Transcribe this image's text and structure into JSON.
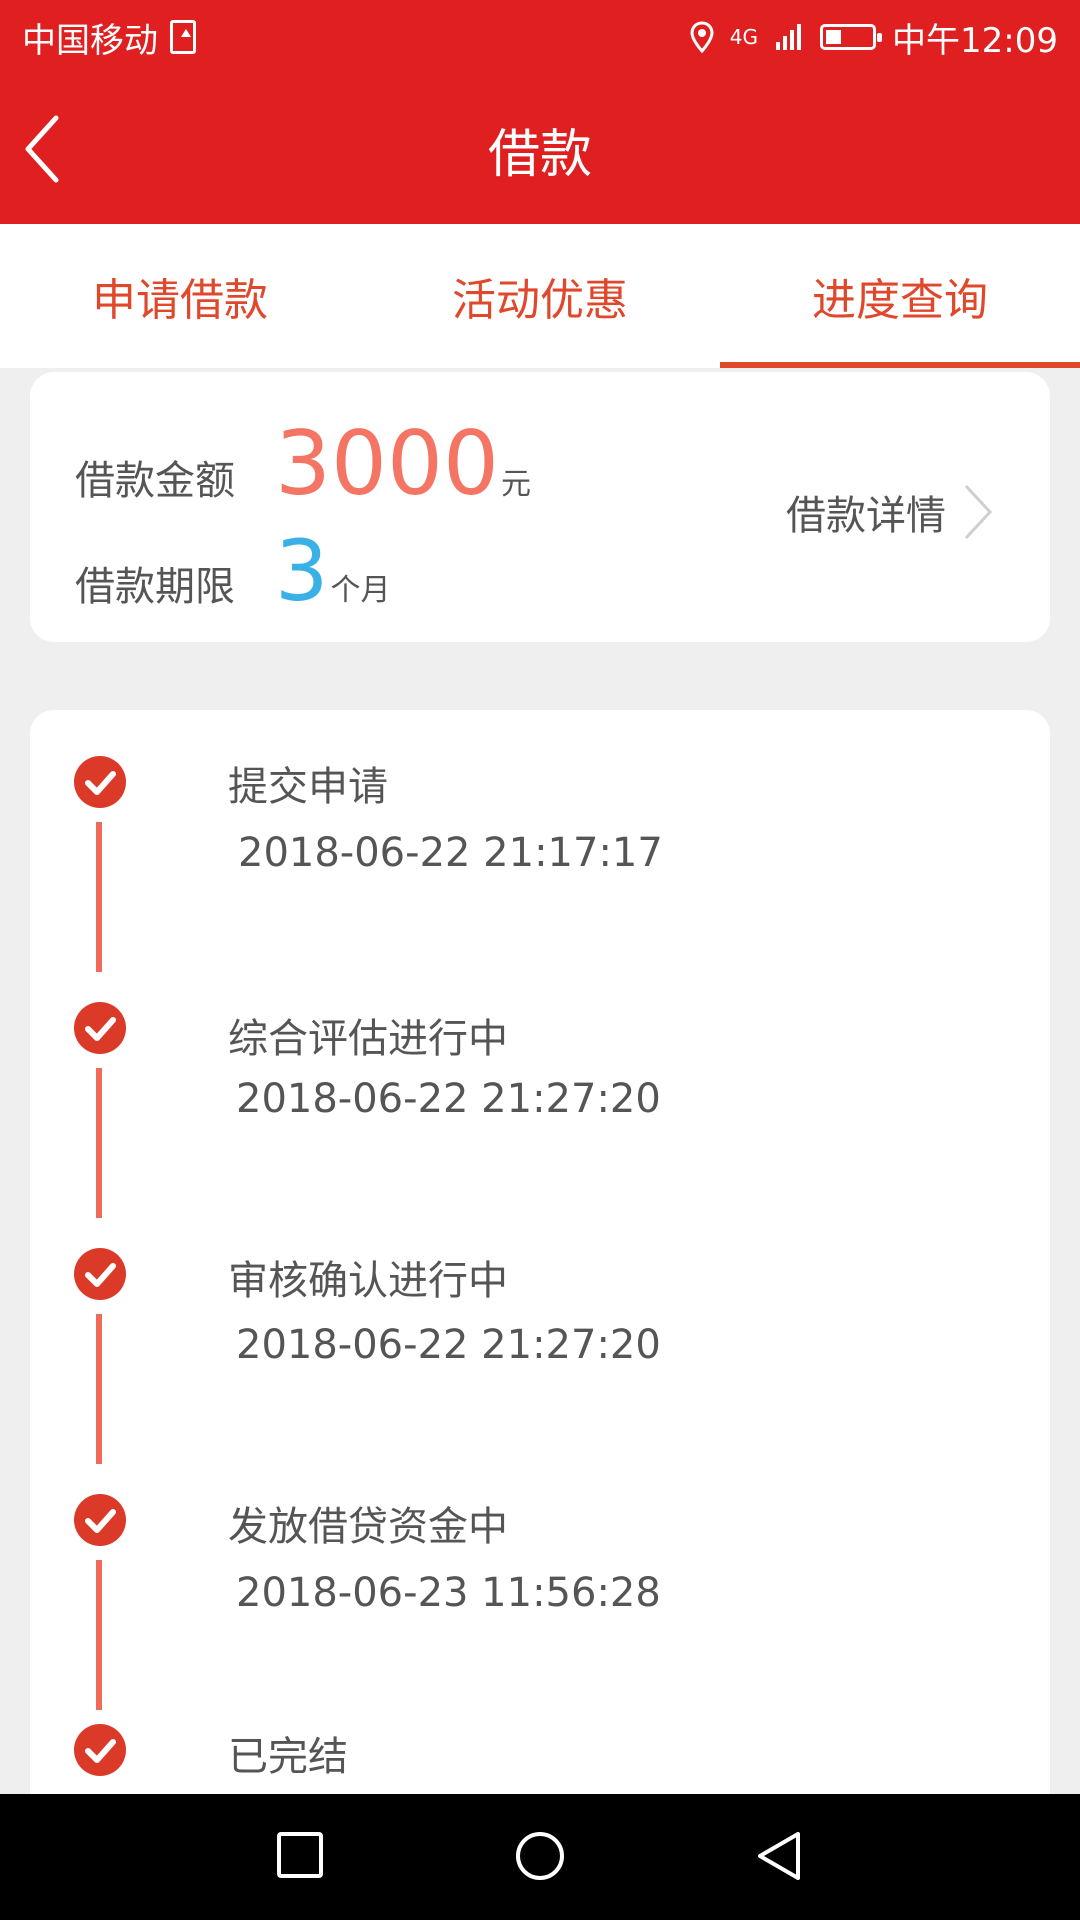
{
  "status_bar": {
    "carrier": "中国移动",
    "network": "4G",
    "time": "中午12:09",
    "battery_level": 0.35,
    "icons": [
      "upload-icon",
      "location-icon",
      "signal-icon",
      "battery-icon"
    ]
  },
  "header": {
    "title": "借款"
  },
  "tabs": [
    {
      "label": "申请借款",
      "active": false
    },
    {
      "label": "活动优惠",
      "active": false
    },
    {
      "label": "进度查询",
      "active": true
    }
  ],
  "loan": {
    "amount_label": "借款金额",
    "amount_value": "3000",
    "amount_unit": "元",
    "term_label": "借款期限",
    "term_value": "3",
    "term_unit": "个月",
    "details_label": "借款详情"
  },
  "progress": [
    {
      "title": "提交申请",
      "time": "2018-06-22 21:17:17"
    },
    {
      "title": "综合评估进行中",
      "time": "2018-06-22 21:27:20"
    },
    {
      "title": "审核确认进行中",
      "time": "2018-06-22 21:27:20"
    },
    {
      "title": "发放借贷资金中",
      "time": "2018-06-23 11:56:28"
    },
    {
      "title": "已完结",
      "time": ""
    }
  ],
  "colors": {
    "brand_red": "#e02020",
    "accent_red": "#e0482c",
    "amount_color": "#f47563",
    "term_color": "#39b0e6",
    "check_color": "#dc3a29"
  }
}
